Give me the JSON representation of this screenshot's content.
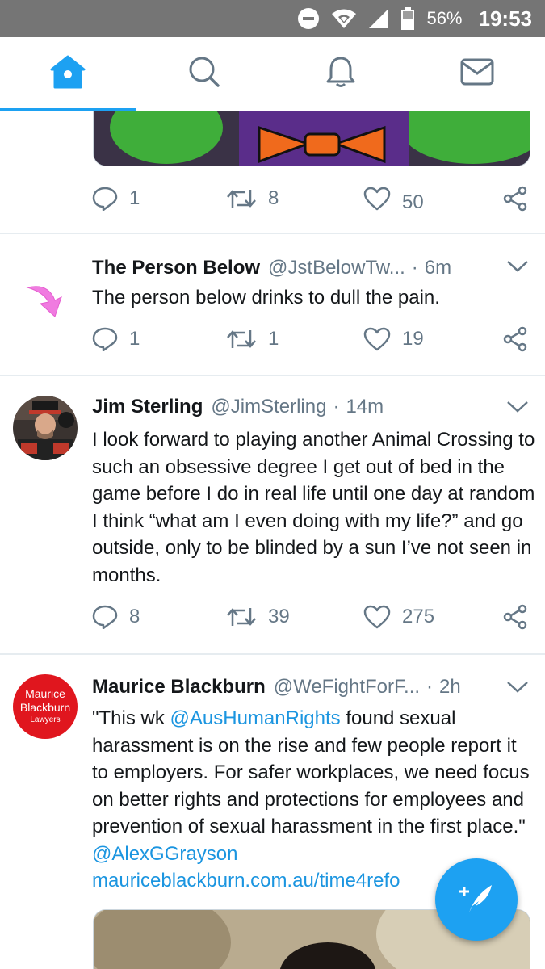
{
  "status_bar": {
    "battery": "56%",
    "time": "19:53"
  },
  "tabs": [
    {
      "name": "home",
      "active": true
    },
    {
      "name": "search",
      "active": false
    },
    {
      "name": "notifications",
      "active": false
    },
    {
      "name": "messages",
      "active": false
    }
  ],
  "prev_tweet": {
    "replies": "1",
    "retweets": "8",
    "likes": "50"
  },
  "tweets": [
    {
      "name": "The Person Below",
      "handle": "@JstBelowTw...",
      "time": "6m",
      "body": "The person below drinks to dull the pain.",
      "replies": "1",
      "retweets": "1",
      "likes": "19"
    },
    {
      "name": "Jim Sterling",
      "handle": "@JimSterling",
      "time": "14m",
      "body": "I look forward to playing another Animal Crossing to such an obsessive degree I get out of bed in the game before I do in real life until one day at random I think “what am I even doing with my life?” and go outside, only to be blinded by a sun I’ve not seen in months.",
      "replies": "8",
      "retweets": "39",
      "likes": "275"
    },
    {
      "name": "Maurice Blackburn",
      "handle": "@WeFightForF...",
      "time": "2h",
      "body_start": "\"This wk ",
      "mention1": "@AusHumanRights",
      "body_mid": " found sexual harassment is on the rise and few people report it to employers. For safer workplaces, we need focus on better rights and protections for employees and prevention of sexual harassment in the first place.\" ",
      "mention2": "@AlexGGrayson",
      "link": "mauriceblackburn.com.au/time4refo",
      "avatar_text": [
        "Maurice",
        "Blackburn",
        "Lawyers"
      ]
    }
  ],
  "colors": {
    "accent": "#1da1f2",
    "link": "#1b95e0",
    "muted": "#657786",
    "status_bar": "#757575"
  }
}
